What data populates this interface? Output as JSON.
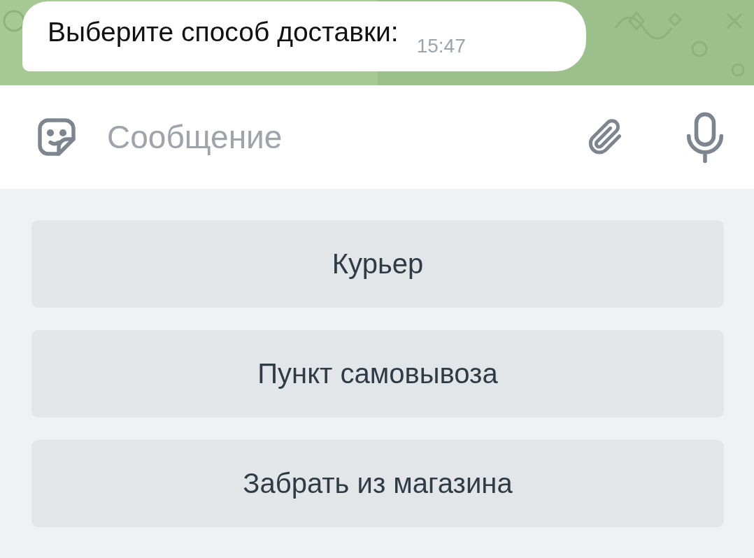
{
  "message": {
    "text": "Выберите способ доставки:",
    "time": "15:47"
  },
  "composer": {
    "placeholder": "Сообщение"
  },
  "keyboard": {
    "buttons": [
      {
        "label": "Курьер"
      },
      {
        "label": "Пункт самовывоза"
      },
      {
        "label": "Забрать из магазина"
      }
    ]
  }
}
